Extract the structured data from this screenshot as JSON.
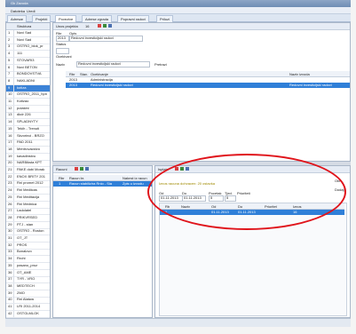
{
  "window": {
    "title": "Gk Zavoda"
  },
  "menu": {
    "items": [
      "Datoteka",
      "Uredi"
    ]
  },
  "tabs": [
    {
      "label": "Adresar"
    },
    {
      "label": "Projekti"
    },
    {
      "label": "Povezive"
    },
    {
      "label": "Adrese zgrada"
    },
    {
      "label": "Popravni radovi"
    },
    {
      "label": "Prilozi"
    }
  ],
  "left_panel": {
    "header_col": "Struktura",
    "rows": [
      {
        "n": "1",
        "t": "Novi Sad"
      },
      {
        "n": "2",
        "t": "Novi Sad"
      },
      {
        "n": "3",
        "t": "OSTRO_blok_pr"
      },
      {
        "n": "4",
        "t": "111"
      },
      {
        "n": "5",
        "t": "STOVARI3"
      },
      {
        "n": "6",
        "t": "Novi BETON"
      },
      {
        "n": "7",
        "t": "BONDOVSTVA"
      },
      {
        "n": "8",
        "t": "NAKLADNI"
      },
      {
        "n": "9",
        "t": "kotiza"
      },
      {
        "n": "10",
        "t": "OSTRO_2011_hpn"
      },
      {
        "n": "11",
        "t": "Kotizao"
      },
      {
        "n": "12",
        "t": "polakini"
      },
      {
        "n": "13",
        "t": "dkdr 226"
      },
      {
        "n": "14",
        "t": "SPLADNYTY"
      },
      {
        "n": "15",
        "t": "Tekih - Trenuti"
      },
      {
        "n": "16",
        "t": "Skvorinci - BRZO"
      },
      {
        "n": "17",
        "t": "PAD 2011"
      },
      {
        "n": "18",
        "t": "Mentrovacstvo"
      },
      {
        "n": "19",
        "t": "kavadinstvu"
      },
      {
        "n": "20",
        "t": "NARBiksta KPT"
      },
      {
        "n": "21",
        "t": "PAKE dobi Morak"
      },
      {
        "n": "22",
        "t": "ENOX BRITY 201"
      },
      {
        "n": "23",
        "t": "Rni promet 2012"
      },
      {
        "n": "24",
        "t": "Rni Mediicas"
      },
      {
        "n": "25",
        "t": "Rni Meditacija"
      },
      {
        "n": "26",
        "t": "Rni Mednica"
      },
      {
        "n": "27",
        "t": "Ladolatel"
      },
      {
        "n": "28",
        "t": "PRIKVRSED"
      },
      {
        "n": "29",
        "t": "PTJ - stan"
      },
      {
        "n": "30",
        "t": "OSTRO - Roston"
      },
      {
        "n": "31",
        "t": "OT_JT"
      },
      {
        "n": "32",
        "t": "PROS"
      },
      {
        "n": "33",
        "t": "Bonalovo"
      },
      {
        "n": "34",
        "t": "Rrohi"
      },
      {
        "n": "35",
        "t": "pasano_proz"
      },
      {
        "n": "36",
        "t": "OT_AME"
      },
      {
        "n": "37",
        "t": "TYR - VRO"
      },
      {
        "n": "38",
        "t": "MEDTECH"
      },
      {
        "n": "39",
        "t": "ZMO"
      },
      {
        "n": "40",
        "t": "Rni Ataiwa"
      },
      {
        "n": "41",
        "t": "LRI 2011-2014"
      },
      {
        "n": "42",
        "t": "OSTGLMLOK"
      }
    ]
  },
  "top_panel": {
    "toolbar_title": "Unos projekta",
    "toolbar_value": "16",
    "label_rbr": "Rbr",
    "label_opis": "Opis",
    "label_status": "Status",
    "value_status": "2013",
    "label_desc": "Ocekivani",
    "desc_value": "Redovni investicijski radovi",
    "filter_label": "Naziv",
    "filter_value": "Redovni investicijski radovi",
    "filter_btn": "Pretrazi",
    "grid_cols": [
      "Rbr",
      "Stav.",
      "Ocekivanje",
      "Naziv izvoda"
    ],
    "grid_rows": [
      {
        "a": "2013",
        "b": "",
        "c": "Administracija",
        "d": ""
      },
      {
        "a": "2013",
        "b": "",
        "c": "Redovni investicijski radovi",
        "d": "Redovni investicijski radovi"
      }
    ]
  },
  "mid_panel": {
    "toolbar_title": "Racuni",
    "cols": [
      "Rbr",
      "Racun br.",
      "Naknst iz racun"
    ],
    "rows": [
      {
        "a": "1",
        "b": "Racun stabilizira Rnio - Sia",
        "c": "Zpis u izvodu"
      }
    ]
  },
  "right_panel": {
    "toolbar_title": "Isplate",
    "info_text": "Iznos racuna dohvacen: 20 ostavka",
    "label_a": "Od",
    "label_b": "Do",
    "label_c": "Pocetak",
    "label_d": "Tjed.",
    "label_e": "Prioriteti",
    "val_a": "01.11.2013",
    "val_b": "01.11.2013",
    "val_c": "5",
    "val_d": "5",
    "btn_1": "Obri",
    "btn_2": "Dodaj",
    "grid_cols": [
      "Rb",
      "Naziv",
      "Od",
      "Do",
      "Prioritet",
      "Iznos"
    ],
    "grid_rows": [
      {
        "a": "1",
        "b": "",
        "c": "01.11.2013",
        "d": "01.11.2013",
        "e": "",
        "f": "16"
      }
    ]
  },
  "colors": {
    "selection": "#2f7fd8",
    "annotation": "#e0141b"
  }
}
